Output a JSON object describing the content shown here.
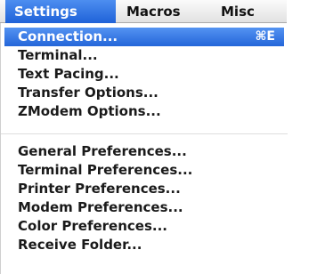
{
  "menubar": {
    "items": [
      {
        "label": "Settings"
      },
      {
        "label": "Macros"
      },
      {
        "label": "Misc"
      }
    ]
  },
  "menu": {
    "group1": [
      {
        "label": "Connection...",
        "shortcut": "⌘E"
      },
      {
        "label": "Terminal..."
      },
      {
        "label": "Text Pacing..."
      },
      {
        "label": "Transfer Options..."
      },
      {
        "label": "ZModem Options..."
      }
    ],
    "group2": [
      {
        "label": "General Preferences..."
      },
      {
        "label": "Terminal Preferences..."
      },
      {
        "label": "Printer Preferences..."
      },
      {
        "label": "Modem Preferences..."
      },
      {
        "label": "Color Preferences..."
      },
      {
        "label": "Receive Folder..."
      }
    ]
  },
  "colors": {
    "highlight": "#2466d9",
    "text": "#1a1a1a"
  }
}
